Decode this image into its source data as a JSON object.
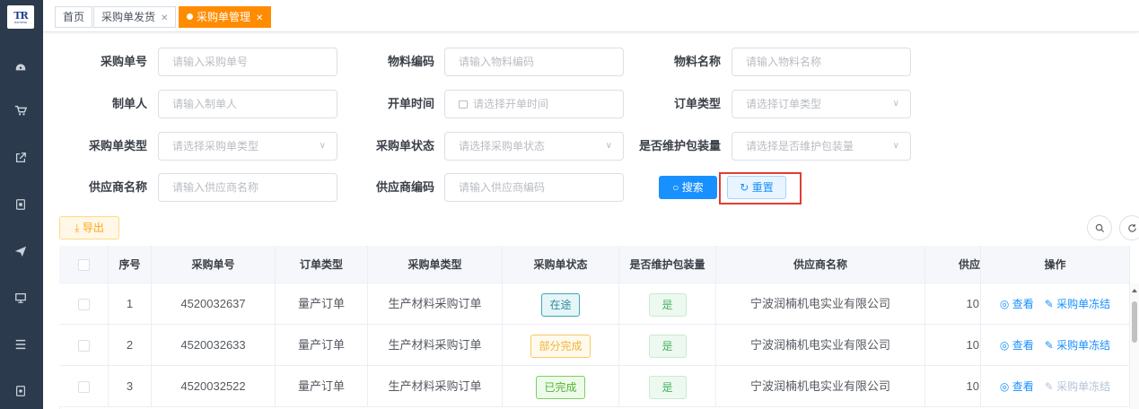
{
  "app": {
    "logo_text": "TR",
    "logo_sub": "RIGTRINE"
  },
  "sidebar": {
    "icons": [
      "dashboard-icon",
      "cart-icon",
      "external-link-icon",
      "square-icon",
      "send-icon",
      "monitor-icon",
      "list-icon",
      "cube-icon"
    ]
  },
  "tabs": [
    {
      "label": "首页",
      "closable": false,
      "active": false
    },
    {
      "label": "采购单发货",
      "closable": true,
      "active": false
    },
    {
      "label": "采购单管理",
      "closable": true,
      "active": true
    }
  ],
  "form": {
    "po_no": {
      "label": "采购单号",
      "placeholder": "请输入采购单号"
    },
    "material_code": {
      "label": "物料编码",
      "placeholder": "请输入物料编码"
    },
    "material_name": {
      "label": "物料名称",
      "placeholder": "请输入物料名称"
    },
    "creator": {
      "label": "制单人",
      "placeholder": "请输入制单人"
    },
    "open_time": {
      "label": "开单时间",
      "placeholder": "请选择开单时间"
    },
    "order_type": {
      "label": "订单类型",
      "placeholder": "请选择订单类型"
    },
    "po_type": {
      "label": "采购单类型",
      "placeholder": "请选择采购单类型"
    },
    "po_status": {
      "label": "采购单状态",
      "placeholder": "请选择采购单状态"
    },
    "maintain_pack": {
      "label": "是否维护包装量",
      "placeholder": "请选择是否维护包装量"
    },
    "supplier_name": {
      "label": "供应商名称",
      "placeholder": "请输入供应商名称"
    },
    "supplier_code": {
      "label": "供应商编码",
      "placeholder": "请输入供应商编码"
    }
  },
  "buttons": {
    "search": "搜索",
    "reset": "重置",
    "export": "导出"
  },
  "table": {
    "headers": {
      "index": "序号",
      "po_no": "采购单号",
      "order_type": "订单类型",
      "po_type": "采购单类型",
      "po_status": "采购单状态",
      "maintain_pack": "是否维护包装量",
      "supplier_name": "供应商名称",
      "supplier_code": "供应",
      "actions": "操作"
    },
    "rows": [
      {
        "index": "1",
        "po_no": "4520032637",
        "order_type": "量产订单",
        "po_type": "生产材料采购订单",
        "po_status": "在途",
        "maintain_pack": "是",
        "supplier_name": "宁波润楠机电实业有限公司",
        "supplier_code": "10",
        "view": "查看",
        "freeze": "采购单冻结"
      },
      {
        "index": "2",
        "po_no": "4520032633",
        "order_type": "量产订单",
        "po_type": "生产材料采购订单",
        "po_status": "部分完成",
        "maintain_pack": "是",
        "supplier_name": "宁波润楠机电实业有限公司",
        "supplier_code": "10",
        "view": "查看",
        "freeze": "采购单冻结"
      },
      {
        "index": "3",
        "po_no": "4520032522",
        "order_type": "量产订单",
        "po_type": "生产材料采购订单",
        "po_status": "已完成",
        "maintain_pack": "是",
        "supplier_name": "宁波润楠机电实业有限公司",
        "supplier_code": "10",
        "view": "查看",
        "freeze": "采购单冻结"
      }
    ]
  },
  "colors": {
    "sidebar": "#2b3a4d",
    "accent": "#ff8c00",
    "primary": "#1890ff",
    "highlight": "#e03c31"
  }
}
